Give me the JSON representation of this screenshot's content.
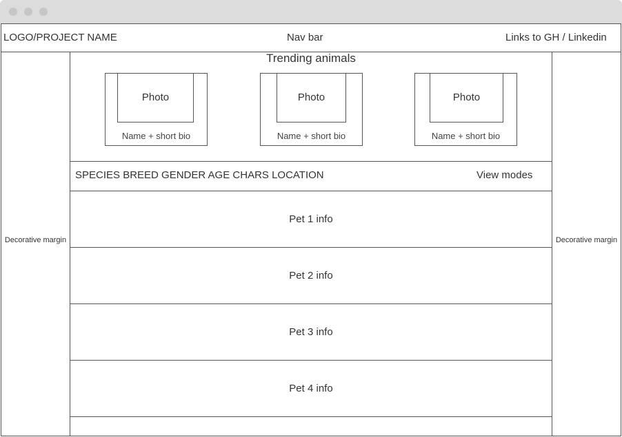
{
  "navbar": {
    "logo": "LOGO/PROJECT NAME",
    "center": "Nav bar",
    "links": "Links to GH / Linkedin"
  },
  "margins": {
    "left": "Decorative margin",
    "right": "Decorative margin"
  },
  "trending": {
    "title": "Trending animals",
    "cards": [
      {
        "photo": "Photo",
        "caption": "Name + short bio"
      },
      {
        "photo": "Photo",
        "caption": "Name + short bio"
      },
      {
        "photo": "Photo",
        "caption": "Name + short bio"
      }
    ]
  },
  "filters": {
    "labels": "SPECIES BREED GENDER AGE CHARS LOCATION",
    "view_modes": "View modes"
  },
  "pets": [
    {
      "info": "Pet 1 info"
    },
    {
      "info": "Pet 2 info"
    },
    {
      "info": "Pet 3 info"
    },
    {
      "info": "Pet 4 info"
    }
  ]
}
